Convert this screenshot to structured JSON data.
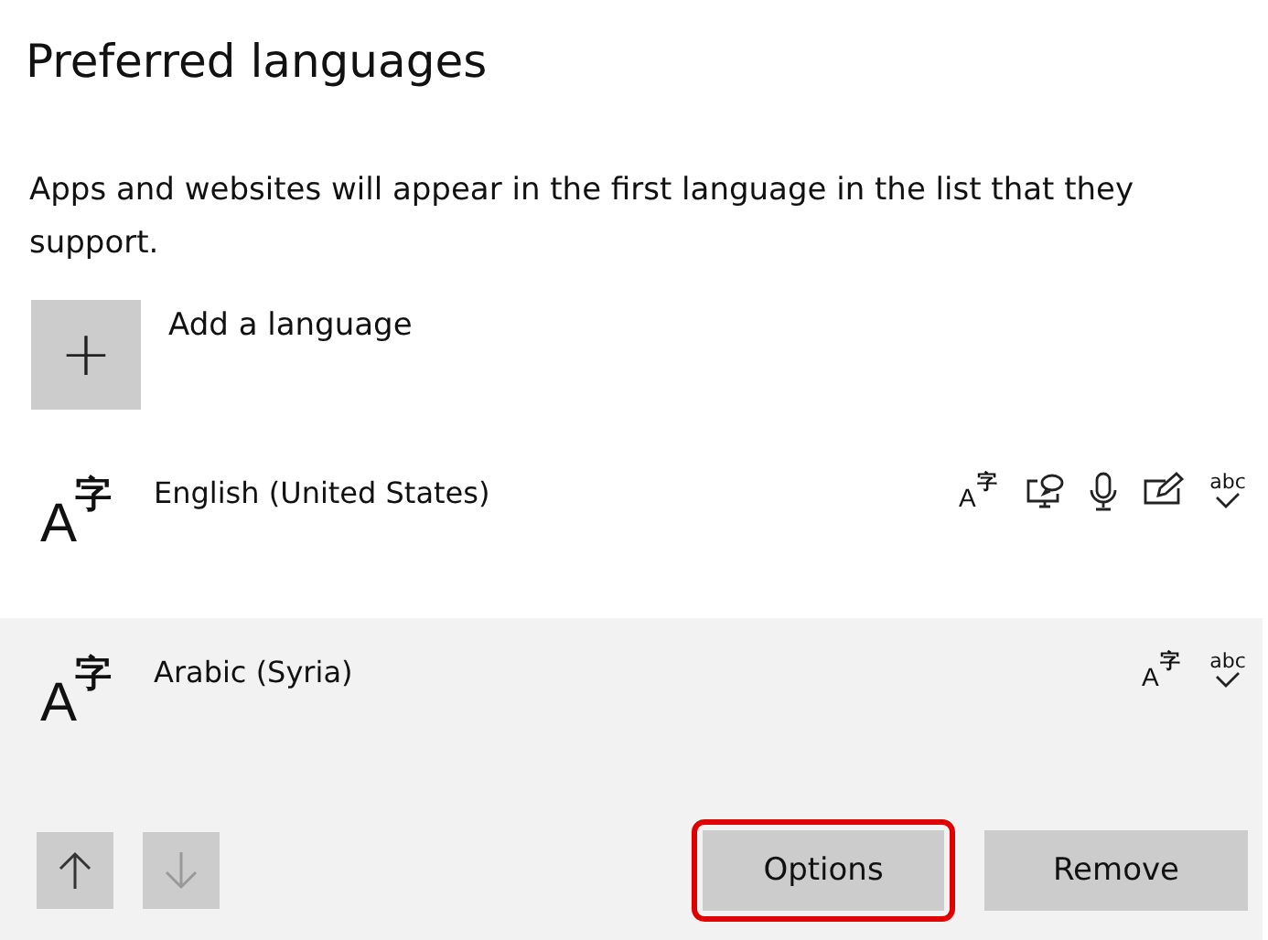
{
  "title": "Preferred languages",
  "description": "Apps and websites will appear in the first language in the list that they support.",
  "add_button": {
    "icon": "+",
    "label": "Add a language"
  },
  "languages": [
    {
      "name": "English (United States)",
      "icon": [
        "A",
        "字"
      ],
      "selected": false,
      "features": [
        {
          "kind": "language-pack",
          "glyphs": [
            "A",
            "字"
          ]
        },
        {
          "kind": "display"
        },
        {
          "kind": "microphone"
        },
        {
          "kind": "handwriting"
        },
        {
          "kind": "spelling",
          "text": "abc"
        }
      ]
    },
    {
      "name": "Arabic (Syria)",
      "icon": [
        "A",
        "字"
      ],
      "selected": true,
      "features": [
        {
          "kind": "language-pack",
          "glyphs": [
            "A",
            "字"
          ]
        },
        {
          "kind": "spelling",
          "text": "abc"
        }
      ]
    }
  ],
  "move_up": {
    "disabled": false
  },
  "move_down": {
    "disabled": true
  },
  "buttons": [
    {
      "label": "Options",
      "highlighted": true
    },
    {
      "label": "Remove",
      "highlighted": false
    }
  ]
}
